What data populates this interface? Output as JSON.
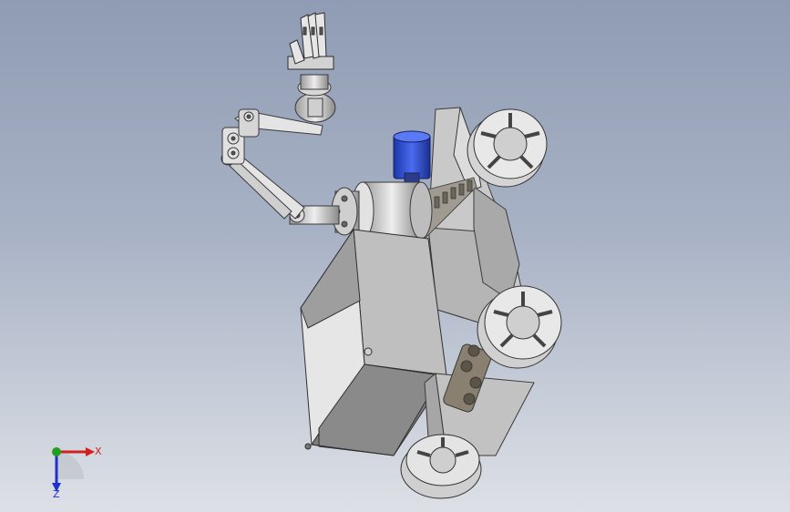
{
  "viewport": {
    "background_top": "#8f9cb4",
    "background_bottom": "#dde0e6"
  },
  "model": {
    "parts": [
      "gripper-hand",
      "wrist-rotator",
      "upper-arm-link",
      "elbow-joint",
      "forearm-link",
      "shoulder-joint",
      "base-flange",
      "blue-motor",
      "gear-rack",
      "main-housing",
      "open-storage-box",
      "drive-gearbox",
      "front-wheel",
      "middle-wheel",
      "rear-wheel"
    ],
    "colors": {
      "body": "#cfcfcf",
      "shadow": "#8c8c8c",
      "outline": "#3a3a3a",
      "motor": "#2b4fd1",
      "gear": "#7a6e5c"
    }
  },
  "triad": {
    "x_label": "X",
    "z_label": "Z",
    "x_color": "#d22020",
    "y_color": "#20a020",
    "z_color": "#2030d0"
  }
}
